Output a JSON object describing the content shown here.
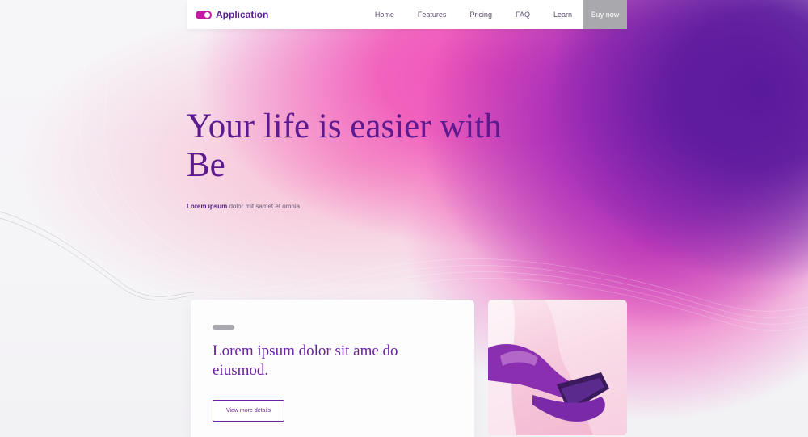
{
  "brand": {
    "name": "Application",
    "logo_icon": "toggle-icon"
  },
  "nav": {
    "items": [
      "Home",
      "Features",
      "Pricing",
      "FAQ",
      "Learn"
    ],
    "cta": "Buy now"
  },
  "hero": {
    "title": "Your life is easier with Be",
    "subtitle_bold": "Lorem ipsum",
    "subtitle_rest": " dolor mit samet et omnia"
  },
  "card": {
    "title": "Lorem ipsum dolor sit ame do eiusmod.",
    "button": "View more details"
  },
  "colors": {
    "accent": "#5c1a8e",
    "pink": "#f04fb7",
    "purple": "#5a1a9c",
    "cta_bg": "#a9a9ad"
  }
}
